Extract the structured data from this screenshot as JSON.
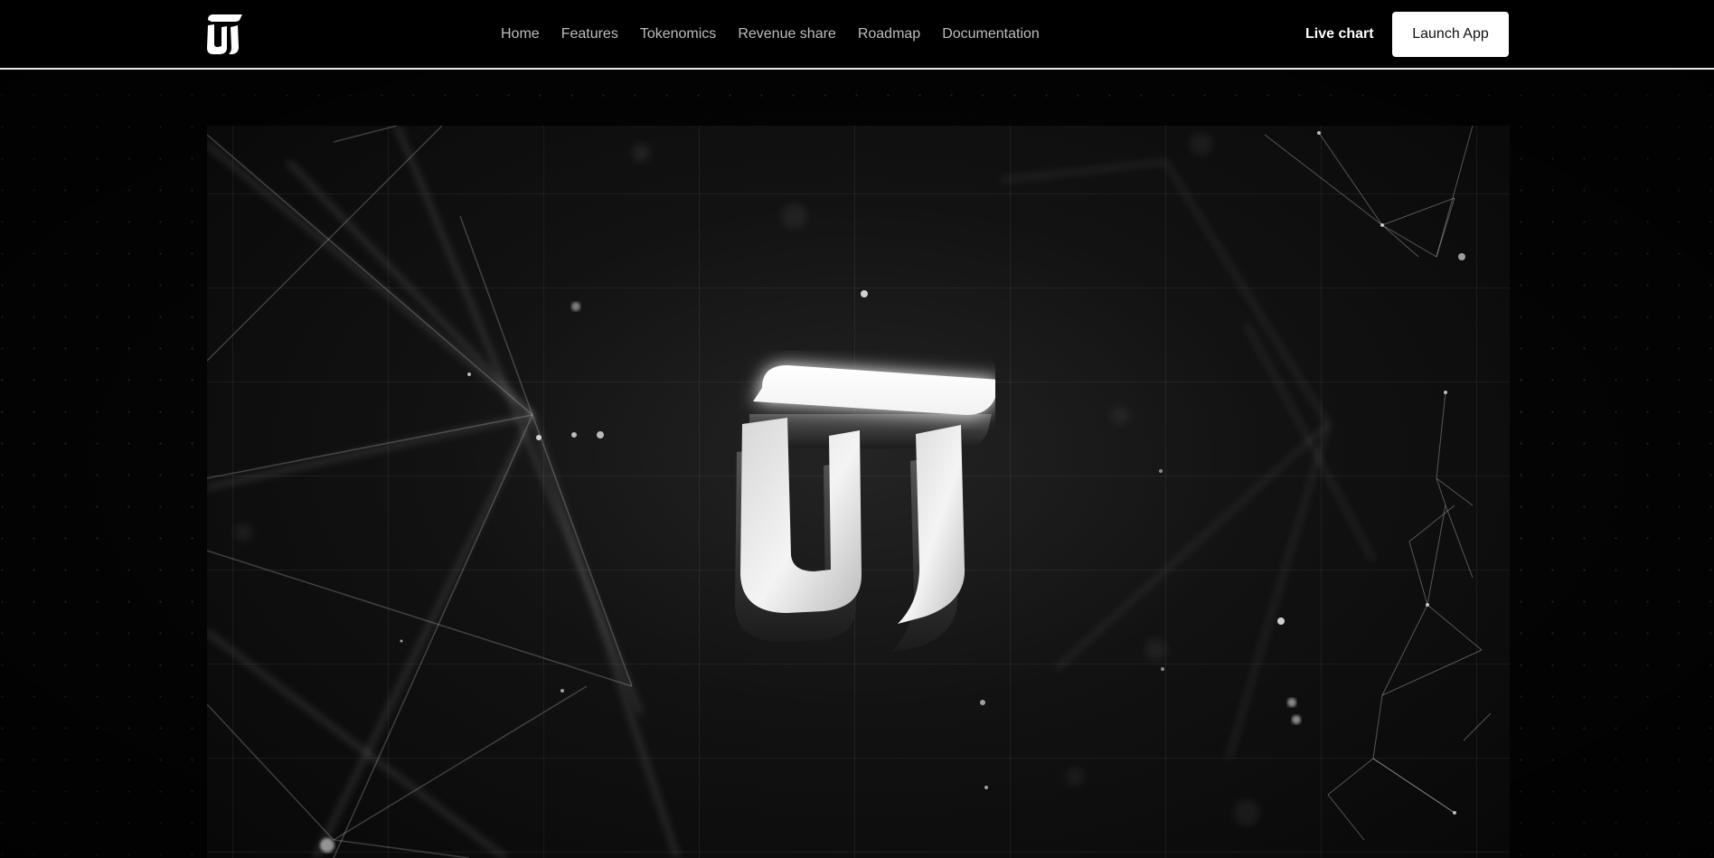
{
  "header": {
    "logo_icon": "tj-logo-icon",
    "nav": [
      {
        "label": "Home"
      },
      {
        "label": "Features"
      },
      {
        "label": "Tokenomics"
      },
      {
        "label": "Revenue share"
      },
      {
        "label": "Roadmap"
      },
      {
        "label": "Documentation"
      }
    ],
    "live_chart_label": "Live chart",
    "launch_label": "Launch App"
  },
  "hero": {
    "logo_icon": "tj-3d-logo-icon",
    "background": "network-plexus-graphic"
  },
  "colors": {
    "background": "#000000",
    "nav_text": "#bdbdbd",
    "button_bg": "#ffffff",
    "button_text": "#111111",
    "divider": "#e8e8e8"
  }
}
